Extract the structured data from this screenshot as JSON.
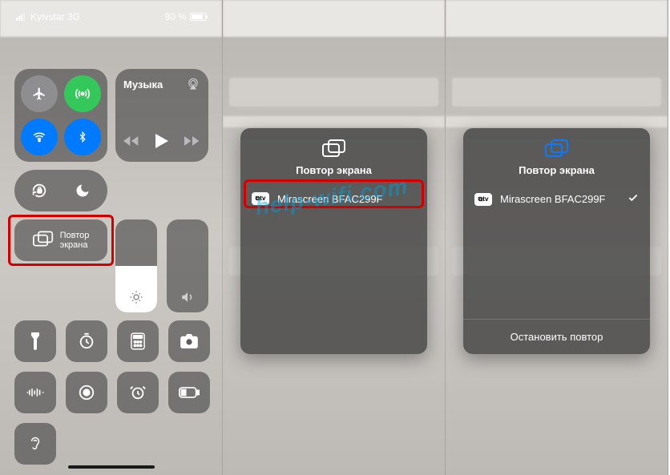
{
  "status": {
    "carrier": "Kyivstar 3G",
    "battery": "90 %"
  },
  "controlCenter": {
    "music_label": "Музыка",
    "mirror_line1": "Повтор",
    "mirror_line2": "экрана"
  },
  "popup": {
    "title": "Повтор экрана",
    "device_chip": "⧉tv",
    "device_name": "Mirascreen BFAC299F",
    "stop_label": "Остановить повтор"
  },
  "watermark": "help-wifi.com"
}
